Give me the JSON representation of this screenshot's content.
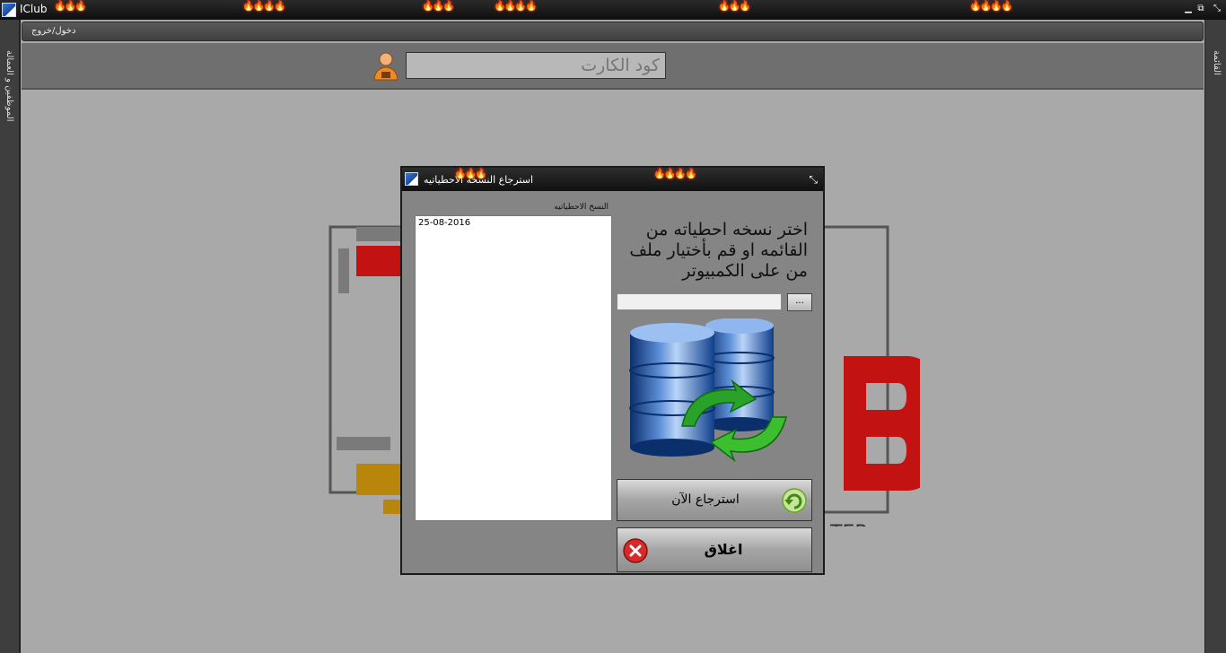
{
  "app": {
    "title": "IClub",
    "window_controls": {
      "minimize": "▁",
      "restore": "⧉",
      "expand": "⤡"
    }
  },
  "side": {
    "left_label": "الموظفين و العمالة",
    "right_label": "القائمة"
  },
  "menu": {
    "login_logout": "دخول/خروج"
  },
  "search": {
    "card_code_placeholder": "كود الكارت",
    "user_icon": "user-icon"
  },
  "dialog": {
    "title": "استرجاع النسخه الاحطياتيه",
    "backups_label": "النسخ الاحطياتيه",
    "backups": [
      "25-08-2016"
    ],
    "instruction": "اختر نسخه احطياته من القائمه او قم بأختيار ملف من على الكمبيوتر",
    "file_path": "",
    "browse_label": "...",
    "restore_label": "استرجاع الآن",
    "close_label": "اغلاق"
  },
  "colors": {
    "background": "#a9a9a9",
    "titlebar": "#111111",
    "dialog": "#858585",
    "logo_red": "#c31212",
    "logo_gold": "#b8860b"
  }
}
